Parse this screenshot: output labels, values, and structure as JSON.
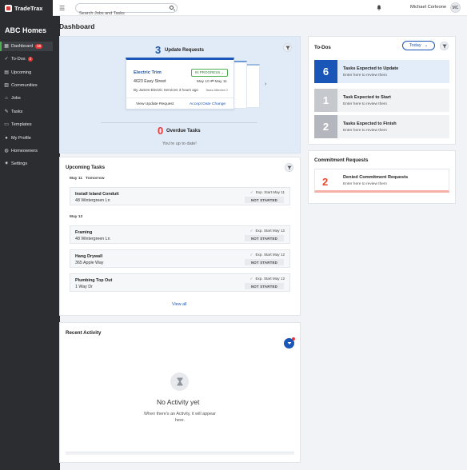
{
  "app": {
    "name": "TradeTrax",
    "org": "ABC Homes"
  },
  "search": {
    "placeholder": "Search Jobs and Tasks"
  },
  "user": {
    "name": "Michael Corleone",
    "initials": "MC"
  },
  "nav": [
    {
      "label": "Dashboard",
      "icon": "dashboard-icon",
      "glyph": "▦",
      "badge": "58"
    },
    {
      "label": "To-Dos",
      "icon": "check-circle-icon",
      "glyph": "✓",
      "badge": "2"
    },
    {
      "label": "Upcoming",
      "icon": "calendar-icon",
      "glyph": "▤",
      "badge": ""
    },
    {
      "label": "Communities",
      "icon": "communities-icon",
      "glyph": "▥",
      "badge": ""
    },
    {
      "label": "Jobs",
      "icon": "home-icon",
      "glyph": "⌂",
      "badge": ""
    },
    {
      "label": "Tasks",
      "icon": "wrench-icon",
      "glyph": "✎",
      "badge": ""
    },
    {
      "label": "Templates",
      "icon": "templates-icon",
      "glyph": "▭",
      "badge": ""
    },
    {
      "label": "My Profile",
      "icon": "user-icon",
      "glyph": "●",
      "badge": ""
    },
    {
      "label": "Homeowners",
      "icon": "homeowners-icon",
      "glyph": "◍",
      "badge": ""
    },
    {
      "label": "Settings",
      "icon": "gear-icon",
      "glyph": "✷",
      "badge": ""
    }
  ],
  "page": {
    "title": "Dashboard"
  },
  "updates": {
    "count": "3",
    "label": "Update Requests",
    "preview": {
      "title": "Electric Trim",
      "status": "IN PROGRESS",
      "address": "4623 Easy Street",
      "date_from": "May 10",
      "date_to": "May 11",
      "by_prefix": "By",
      "by": "James Electric Services",
      "when": "3 hours ago",
      "affected": "Tasks Affected 0",
      "view": "View Update Request",
      "accept": "Accept Date Change"
    },
    "overdue_count": "0",
    "overdue_label": "Overdue Tasks",
    "overdue_msg": "You're up to date!"
  },
  "upcoming": {
    "title": "Upcoming Tasks",
    "groups": [
      {
        "date": "May 11",
        "extra": "Tomorrow",
        "tasks": [
          {
            "name": "Install Island Conduit",
            "address": "48 Wintergreen Ln",
            "exp": "Exp. Start May 11",
            "status": "NOT STARTED"
          }
        ]
      },
      {
        "date": "May 12",
        "extra": "",
        "tasks": [
          {
            "name": "Framing",
            "address": "48 Wintergreen Ln",
            "exp": "Exp. Start May 12",
            "status": "NOT STARTED"
          },
          {
            "name": "Hang Drywall",
            "address": "365 Apple Way",
            "exp": "Exp. Start May 12",
            "status": "NOT STARTED"
          },
          {
            "name": "Plumbing Top Out",
            "address": "1 Way Dr",
            "exp": "Exp. Start May 12",
            "status": "NOT STARTED"
          }
        ]
      }
    ],
    "view_all": "View all"
  },
  "activity": {
    "title": "Recent Activity",
    "empty_title": "No Activity yet",
    "empty_sub": "When there's an Activity, it will appear here."
  },
  "todos": {
    "title": "To-Dos",
    "filter": "Today",
    "items": [
      {
        "count": "6",
        "title": "Tasks Expected to Update",
        "sub": "Enter here to review them",
        "color": "#1a56b8",
        "bg": "#e3ecf9"
      },
      {
        "count": "1",
        "title": "Task Expected to Start",
        "sub": "Enter here to review them",
        "color": "#c5c8cd",
        "bg": "#f1f2f4"
      },
      {
        "count": "2",
        "title": "Tasks Expected to Finish",
        "sub": "Enter here to review them",
        "color": "#b3b7bd",
        "bg": "#f1f2f4"
      }
    ]
  },
  "commitments": {
    "title": "Commitment Requests",
    "count": "2",
    "label": "Denied Commitment Requests",
    "sub": "Enter here to review them"
  }
}
